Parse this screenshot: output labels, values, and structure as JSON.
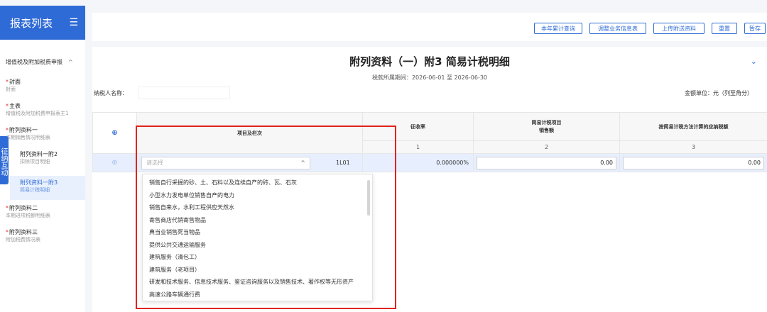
{
  "sidebar": {
    "title": "报表列表",
    "menu_icon": "menu-icon",
    "group": "增值税及附加税费申报",
    "items": [
      {
        "required": "*",
        "label": "封面",
        "sub": "封面"
      },
      {
        "required": "*",
        "label": "主表",
        "sub": "增值税及附加税费申报表主1"
      },
      {
        "required": "*",
        "label": "附列资料一",
        "sub": "本期销售情况明细表"
      },
      {
        "required": "",
        "label": "附列资料一附2",
        "sub": "扣除项目明细"
      },
      {
        "required": "",
        "label": "附列资料一附3",
        "sub": "简易计税明细"
      },
      {
        "required": "*",
        "label": "附列资料二",
        "sub": "本期进项税额明细表"
      },
      {
        "required": "*",
        "label": "附列资料三",
        "sub": "附加税费情况表"
      }
    ],
    "float_tab": "征纳互动"
  },
  "toolbar": {
    "buttons": [
      "本年累计查询",
      "调整业务信息表",
      "上传附送资料",
      "重置",
      "暂存"
    ]
  },
  "form": {
    "title": "附列资料（一）附3 简易计税明细",
    "period": "税款所属期间：2026-06-01 至 2026-06-30",
    "taxpayer_label": "纳税人名称：",
    "unit": "金额单位：元（列至角分）"
  },
  "table": {
    "headers": [
      "项目及栏次",
      "征收率",
      "简易计税项目\n销售额",
      "按简易计税方法计算的应纳税额"
    ],
    "col_numbers": [
      "",
      "",
      "1",
      "2",
      "3"
    ],
    "row": {
      "placeholder": "请选择",
      "line_no": "1L01",
      "rate": "0.000000%",
      "sales": "0.00",
      "tax": "0.00"
    }
  },
  "dropdown": {
    "options": [
      "销售自行采掘的砂、土、石料以及连续自产的砖、瓦、石灰",
      "小型水力发电单位销售自产的电力",
      "销售自来水，水利工程供应天然水",
      "寄售商店代销寄售物品",
      "典当业销售死当物品",
      "提供公共交通运输服务",
      "建筑服务（清包工）",
      "建筑服务（老项目）",
      "研发和技术服务、信息技术服务、鉴证咨询服务以及销售技术、著作权等无形资产",
      "高速公路车辆通行费"
    ]
  },
  "colors": {
    "accent": "#2f6bd6",
    "highlight": "#e0231e",
    "row_bg": "#e7efff"
  }
}
